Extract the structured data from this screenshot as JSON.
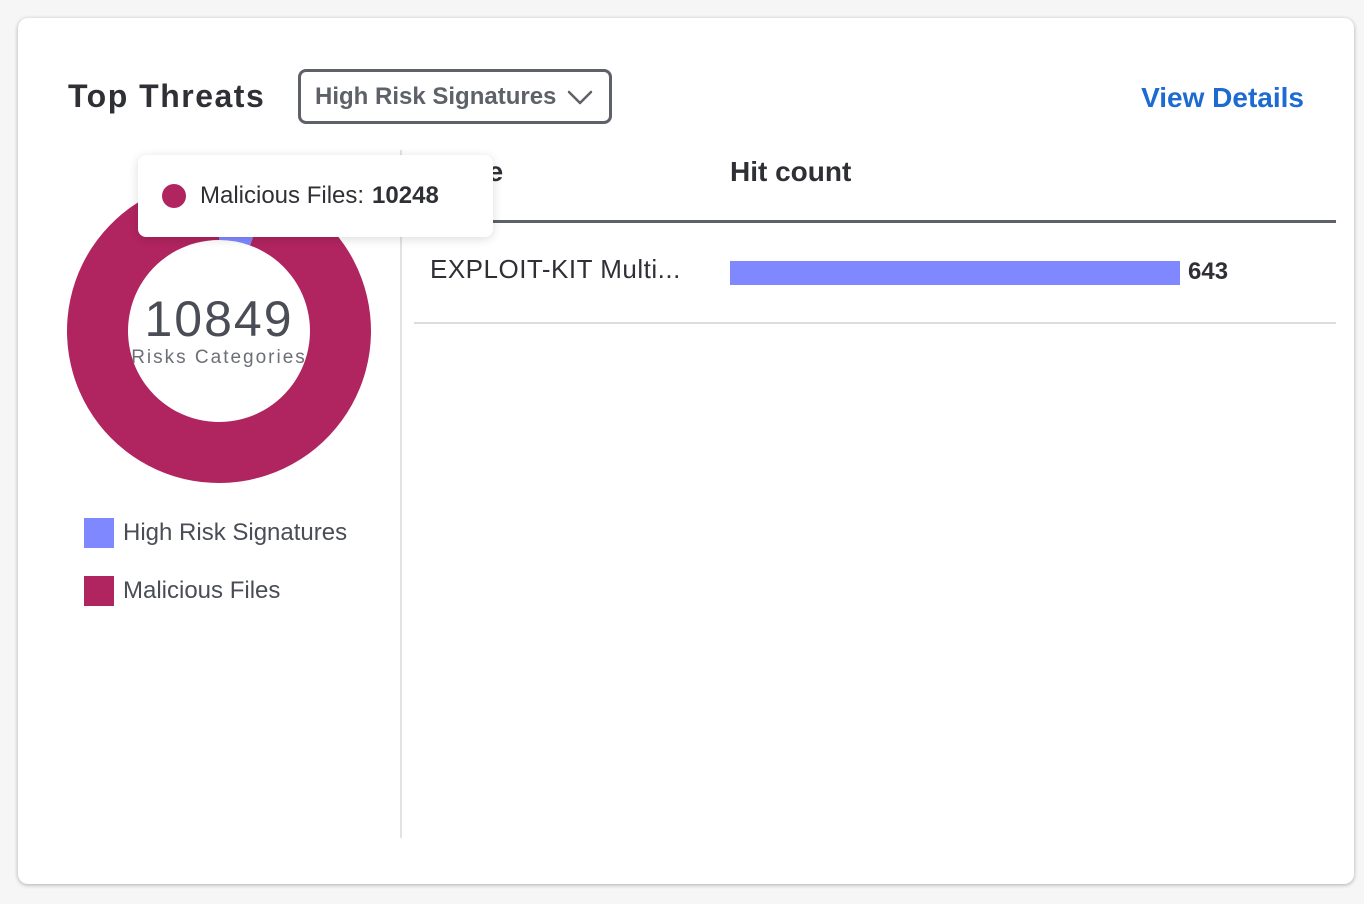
{
  "widget": {
    "title": "Top Threats",
    "dropdown": {
      "selected": "High Risk Signatures",
      "icon": "chevron-down-icon"
    },
    "view_details": "View Details"
  },
  "donut": {
    "total": "10849",
    "label": "Risks Categories",
    "segments": [
      {
        "name": "High Risk Signatures",
        "value": 601,
        "color": "#8088ff"
      },
      {
        "name": "Malicious Files",
        "value": 10248,
        "color": "#b0245f"
      }
    ]
  },
  "legend": [
    {
      "label": "High Risk Signatures",
      "color": "#8088ff"
    },
    {
      "label": "Malicious Files",
      "color": "#b0245f"
    }
  ],
  "tooltip": {
    "label": "Malicious Files:",
    "value": "10248",
    "color": "#b0245f"
  },
  "table": {
    "columns": [
      "name",
      "Hit count"
    ],
    "rows": [
      {
        "name": "EXPLOIT-KIT Multi...",
        "hit_count": 643,
        "hit_count_label": "643",
        "bar_fraction": 1.0,
        "bar_color": "#8088ff"
      }
    ]
  }
}
